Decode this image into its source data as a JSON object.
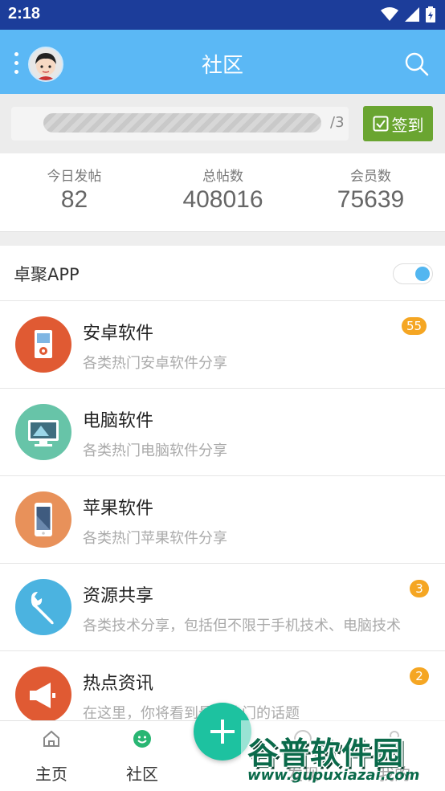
{
  "status_bar": {
    "time": "2:18"
  },
  "app_bar": {
    "title": "社区"
  },
  "sign_in": {
    "progress_total": "/3",
    "button_label": "签到",
    "progress_fraction": 0
  },
  "stats": [
    {
      "label": "今日发帖",
      "value": "82"
    },
    {
      "label": "总帖数",
      "value": "408016"
    },
    {
      "label": "会员数",
      "value": "75639"
    }
  ],
  "toggle": {
    "label": "卓聚APP",
    "on": true
  },
  "forums": [
    {
      "name": "安卓软件",
      "desc": "各类热门安卓软件分享",
      "badge": "55",
      "icon": "android-app-icon",
      "color": "#e05a33"
    },
    {
      "name": "电脑软件",
      "desc": "各类热门电脑软件分享",
      "badge": "",
      "icon": "monitor-icon",
      "color": "#67c4a8"
    },
    {
      "name": "苹果软件",
      "desc": "各类热门苹果软件分享",
      "badge": "",
      "icon": "phone-icon",
      "color": "#e8915a"
    },
    {
      "name": "资源共享",
      "desc": "各类技术分享，包括但不限于手机技术、电脑技术",
      "badge": "3",
      "icon": "wrench-icon",
      "color": "#4bb3e0"
    },
    {
      "name": "热点资讯",
      "desc": "在这里，你将看到最最热门的话题",
      "badge": "2",
      "icon": "megaphone-icon",
      "color": "#e05a33"
    }
  ],
  "bottom_nav": [
    {
      "label": "主页",
      "icon": "home-icon"
    },
    {
      "label": "社区",
      "icon": "smile-icon"
    },
    {
      "label": "发现",
      "icon": "compass-icon"
    },
    {
      "label": "我的",
      "icon": "user-icon"
    }
  ],
  "watermark": {
    "title": "谷普软件园",
    "url": "www.gupuxiazai.com"
  },
  "colors": {
    "app_bar": "#5bb8f5",
    "status_bar": "#1c3d9a",
    "sign_button": "#6aa531",
    "fab": "#1dc2a0",
    "badge": "#f5a623"
  }
}
